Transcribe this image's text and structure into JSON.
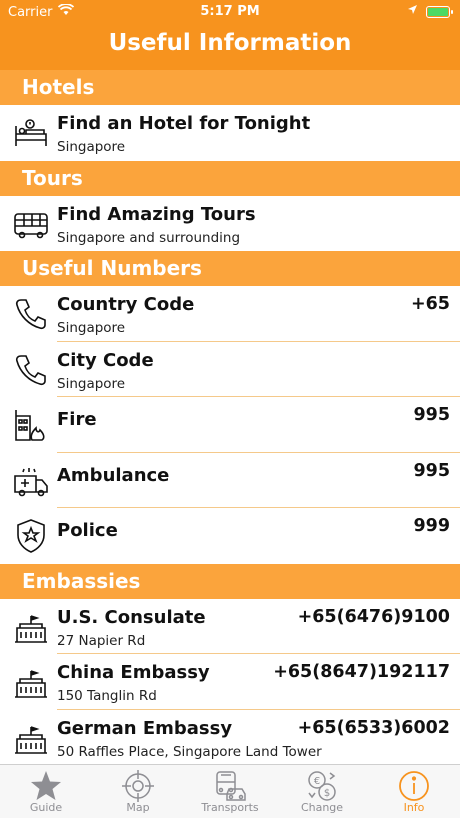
{
  "status": {
    "carrier": "Carrier",
    "time": "5:17 PM"
  },
  "header": {
    "title": "Useful Information"
  },
  "sections": {
    "hotels": {
      "title": "Hotels",
      "rows": [
        {
          "name": "Find an Hotel for Tonight",
          "sub": "Singapore",
          "icon": "hotel-bed-icon"
        }
      ]
    },
    "tours": {
      "title": "Tours",
      "rows": [
        {
          "name": "Find Amazing Tours",
          "sub": "Singapore and surrounding",
          "icon": "bus-icon"
        }
      ]
    },
    "numbers": {
      "title": "Useful Numbers",
      "rows": [
        {
          "name": "Country Code",
          "sub": "Singapore",
          "value": "+65",
          "icon": "phone-icon"
        },
        {
          "name": "City Code",
          "sub": "Singapore",
          "value": "",
          "icon": "phone-icon"
        },
        {
          "name": "Fire",
          "sub": "",
          "value": "995",
          "icon": "fire-building-icon"
        },
        {
          "name": "Ambulance",
          "sub": "",
          "value": "995",
          "icon": "ambulance-icon"
        },
        {
          "name": "Police",
          "sub": "",
          "value": "999",
          "icon": "police-badge-icon"
        }
      ]
    },
    "embassies": {
      "title": "Embassies",
      "rows": [
        {
          "name": "U.S. Consulate",
          "sub": "27 Napier Rd",
          "value": "+65(6476)9100",
          "icon": "embassy-icon"
        },
        {
          "name": "China Embassy",
          "sub": "150 Tanglin Rd",
          "value": "+65(8647)192117",
          "icon": "embassy-icon"
        },
        {
          "name": "German Embassy",
          "sub": "50 Raffles Place, Singapore Land Tower",
          "value": "+65(6533)6002",
          "icon": "embassy-icon"
        }
      ]
    }
  },
  "tabs": [
    {
      "label": "Guide",
      "icon": "star-icon"
    },
    {
      "label": "Map",
      "icon": "crosshair-icon"
    },
    {
      "label": "Transports",
      "icon": "transport-icon"
    },
    {
      "label": "Change",
      "icon": "currency-exchange-icon"
    },
    {
      "label": "Info",
      "icon": "info-icon"
    }
  ],
  "colors": {
    "accent": "#f7931e",
    "section": "#fba43c",
    "inactive_tab": "#8e8e93"
  }
}
